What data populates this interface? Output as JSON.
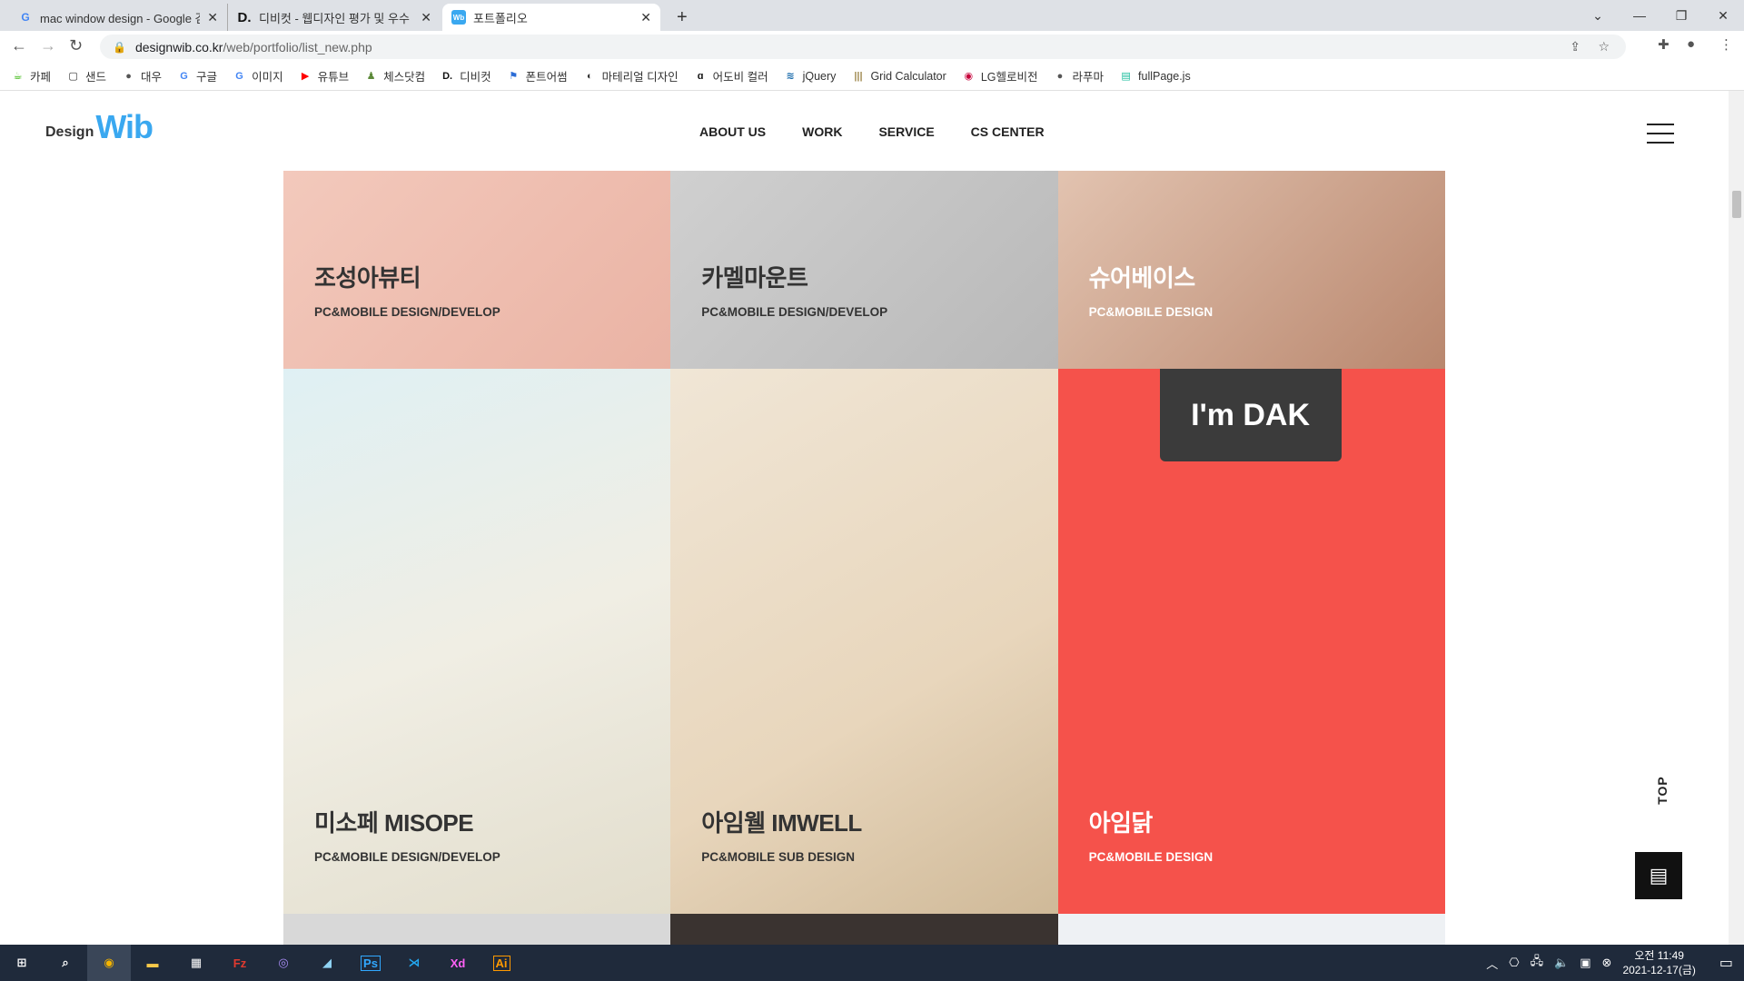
{
  "browser": {
    "tabs": [
      {
        "title": "mac window design - Google 검색",
        "favicon": "google-icon",
        "active": false
      },
      {
        "title": "디비컷 - 웹디자인 평가 및 우수",
        "favicon": "dbcut-icon",
        "active": false
      },
      {
        "title": "포트폴리오",
        "favicon": "wib-icon",
        "active": true
      }
    ],
    "new_tab": "+",
    "url_host": "designwib.co.kr",
    "url_path": "/web/portfolio/list_new.php",
    "bookmarks": [
      {
        "label": "카페",
        "icon": "cafe-icon",
        "color": "#2db400"
      },
      {
        "label": "샌드",
        "icon": "sand-icon",
        "color": "#333333"
      },
      {
        "label": "대우",
        "icon": "globe-icon",
        "color": "#555555"
      },
      {
        "label": "구글",
        "icon": "google-icon",
        "color": "#4285f4"
      },
      {
        "label": "이미지",
        "icon": "google-icon",
        "color": "#4285f4"
      },
      {
        "label": "유튜브",
        "icon": "youtube-icon",
        "color": "#ff0000"
      },
      {
        "label": "체스닷컴",
        "icon": "chess-icon",
        "color": "#5d8a3a"
      },
      {
        "label": "디비컷",
        "icon": "dbcut-icon",
        "color": "#111111"
      },
      {
        "label": "폰트어썸",
        "icon": "flag-icon",
        "color": "#2b6cd6"
      },
      {
        "label": "마테리얼 디자인",
        "icon": "material-icon",
        "color": "#333333"
      },
      {
        "label": "어도비 컬러",
        "icon": "adobe-color-icon",
        "color": "#111111"
      },
      {
        "label": "jQuery",
        "icon": "jquery-icon",
        "color": "#1769aa"
      },
      {
        "label": "Grid Calculator",
        "icon": "grid-icon",
        "color": "#a08a50"
      },
      {
        "label": "LG헬로비전",
        "icon": "lg-icon",
        "color": "#c6003a"
      },
      {
        "label": "라푸마",
        "icon": "globe-icon",
        "color": "#555555"
      },
      {
        "label": "fullPage.js",
        "icon": "fullpage-icon",
        "color": "#1abc9c"
      }
    ]
  },
  "site": {
    "logo_design": "Design",
    "logo_wib": "Wib",
    "nav": [
      "ABOUT US",
      "WORK",
      "SERVICE",
      "CS CENTER"
    ],
    "top_label": "TOP",
    "accent": "#3aa8f0",
    "portfolio": [
      {
        "title": "조성아뷰티",
        "subtitle": "PC&MOBILE DESIGN/DEVELOP",
        "bg": "#f0c2b4"
      },
      {
        "title": "카멜마운트",
        "subtitle": "PC&MOBILE DESIGN/DEVELOP",
        "bg": "#c9c9c9"
      },
      {
        "title": "슈어베이스",
        "subtitle": "PC&MOBILE DESIGN",
        "bg": "#cfa791"
      },
      {
        "title": "미소페 MISOPE",
        "subtitle": "PC&MOBILE DESIGN/DEVELOP",
        "bg": "#eae8df"
      },
      {
        "title": "아임웰 IMWELL",
        "subtitle": "PC&MOBILE SUB DESIGN",
        "bg": "#eee1cd"
      },
      {
        "title": "아임닭",
        "subtitle": "PC&MOBILE DESIGN",
        "bg": "#f5524b",
        "logo": "I'm DAK"
      }
    ]
  },
  "taskbar": {
    "time": "오전 11:49",
    "date": "2021-12-17(금)",
    "apps": [
      "windows-start-icon",
      "search-icon",
      "chrome-icon",
      "file-explorer-icon",
      "calculator-icon",
      "filezilla-icon",
      "github-icon",
      "notepad-icon",
      "photoshop-icon",
      "vscode-icon",
      "xd-icon",
      "illustrator-icon"
    ],
    "app_labels": {
      "ps": "Ps",
      "xd": "Xd",
      "ai": "Ai"
    }
  }
}
